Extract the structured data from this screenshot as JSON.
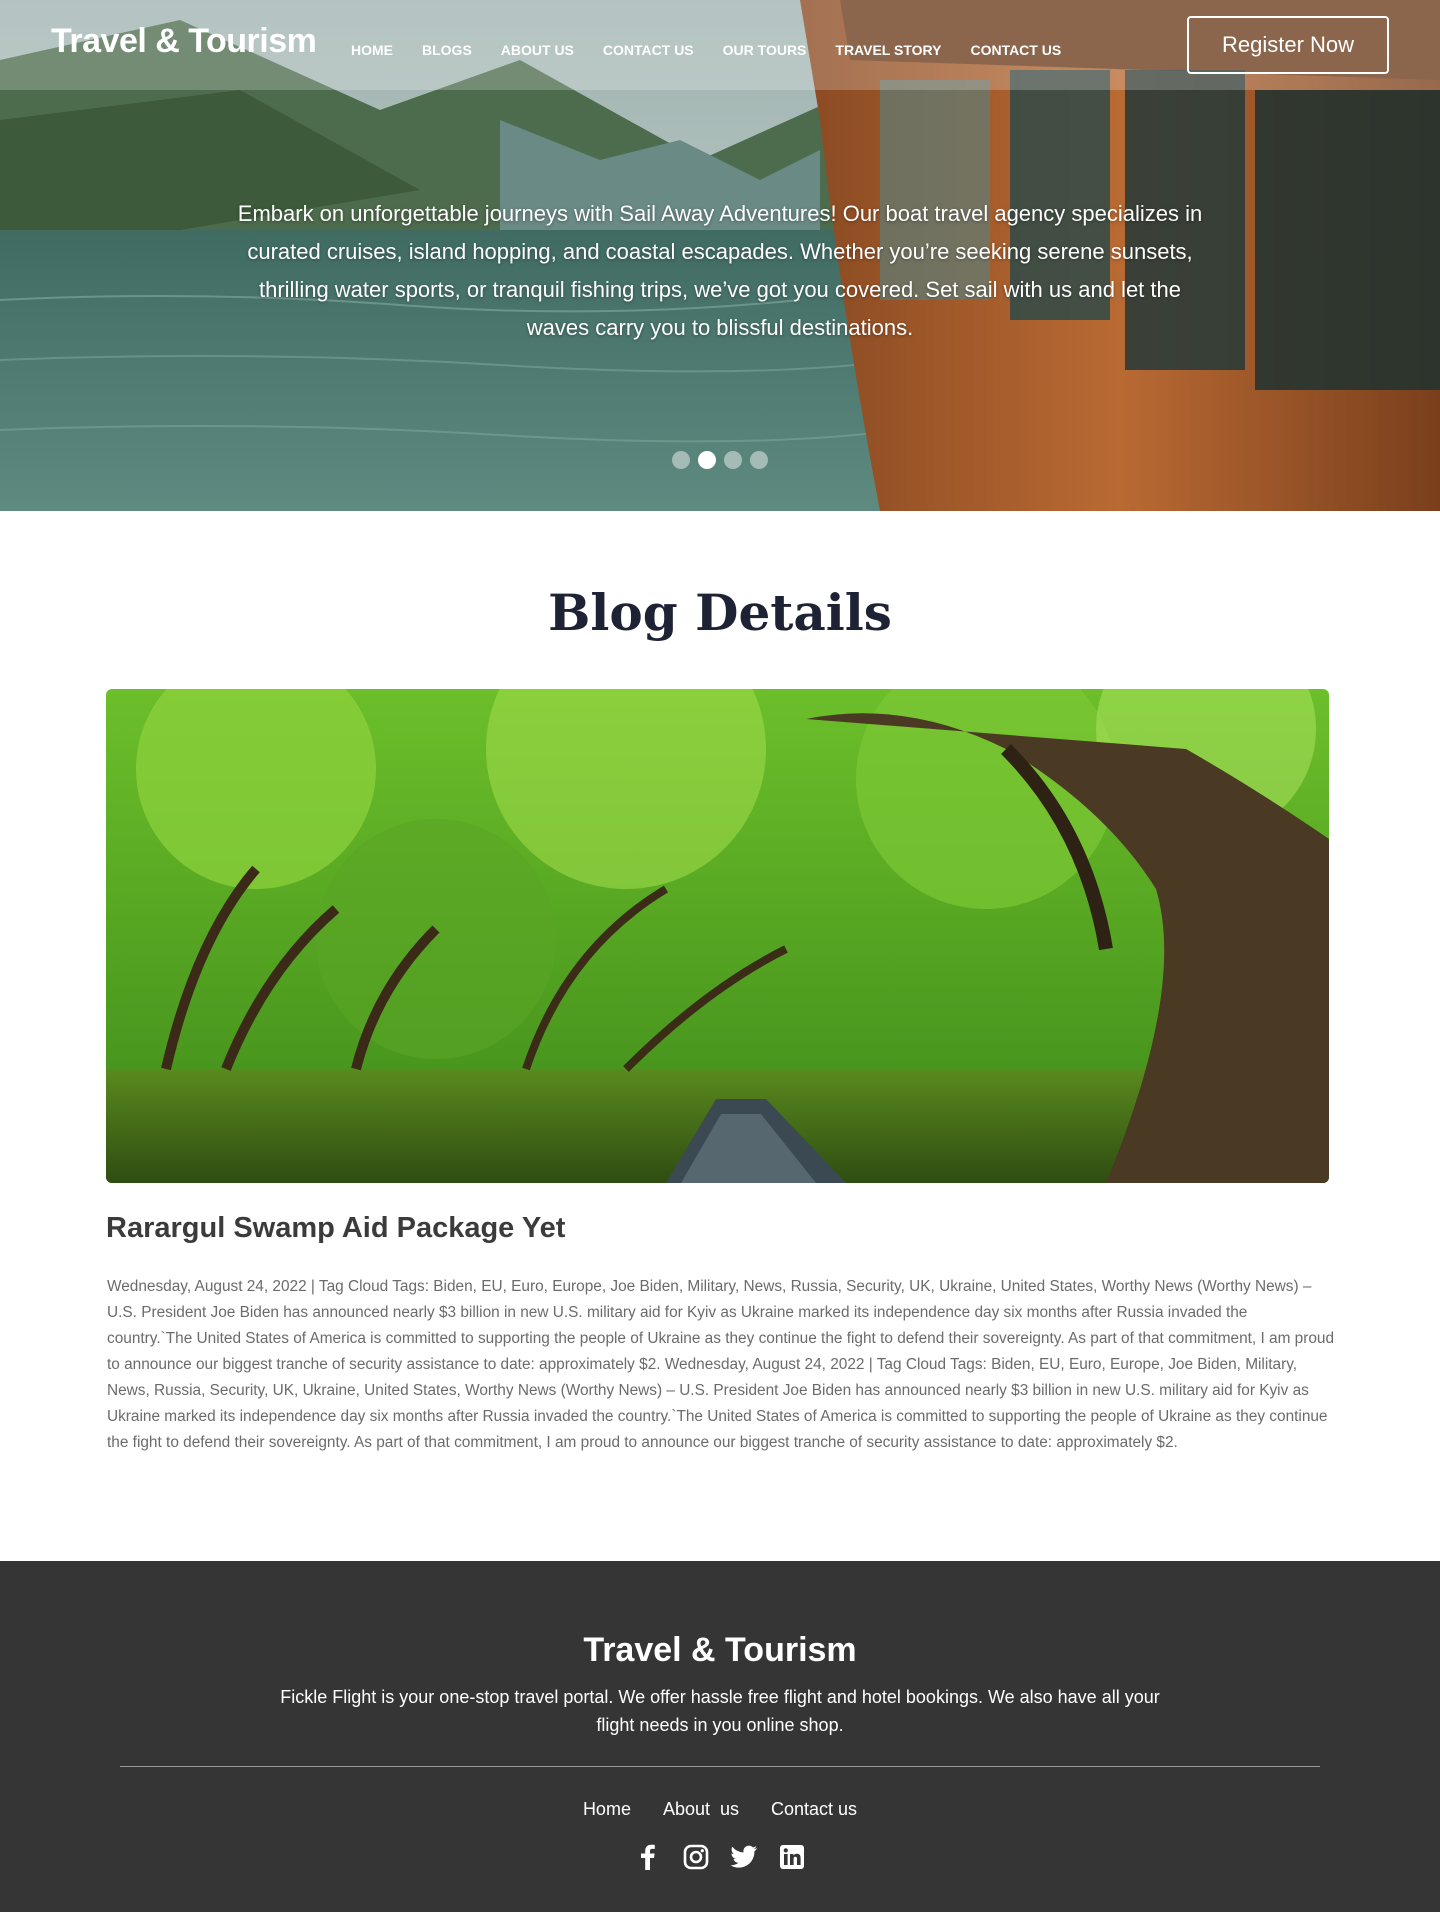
{
  "header": {
    "brand": "Travel & Tourism",
    "nav": [
      "HOME",
      "BLOGS",
      "ABOUT US",
      "CONTACT US",
      "OUR TOURS",
      "TRAVEL STORY",
      "CONTACT US"
    ],
    "register_label": "Register Now"
  },
  "hero": {
    "text": "Embark on unforgettable journeys with Sail Away Adventures! Our boat travel agency specializes in curated cruises, island hopping, and coastal escapades. Whether you’re seeking serene sunsets, thrilling water sports, or tranquil fishing trips, we’ve got you covered. Set sail with us and let the waves carry you to blissful destinations.",
    "slides_total": 4,
    "active_slide": 2
  },
  "blog": {
    "section_title": "Blog Details",
    "post_title": "Rarargul Swamp Aid Package Yet",
    "post_body": "Wednesday, August 24, 2022 | Tag Cloud Tags: Biden, EU, Euro, Europe, Joe Biden, Military, News, Russia, Security, UK, Ukraine, United States, Worthy News (Worthy News) – U.S. President Joe Biden has announced nearly $3 billion in new U.S. military aid for Kyiv as Ukraine marked its independence day six months after Russia invaded the country.`The United States of America is committed to supporting the people of Ukraine as they continue the fight to defend their sovereignty. As part of that commitment, I am proud to announce our biggest tranche of security assistance to date: approximately $2. Wednesday, August 24, 2022 | Tag Cloud Tags: Biden, EU, Euro, Europe, Joe Biden, Military, News, Russia, Security, UK, Ukraine, United States, Worthy News (Worthy News) – U.S. President Joe Biden has announced nearly $3 billion in new U.S. military aid for Kyiv as Ukraine marked its independence day six months after Russia invaded the country.`The United States of America is committed to supporting the people of Ukraine as they continue the fight to defend their sovereignty. As part of that commitment, I am proud to announce our biggest tranche of security assistance to date: approximately $2."
  },
  "footer": {
    "brand": "Travel & Tourism",
    "description": "Fickle Flight is your one-stop travel portal. We offer hassle free flight and hotel bookings. We also have all your flight needs in you online shop.",
    "links": [
      "Home",
      "About  us",
      "Contact us"
    ],
    "socials": [
      "facebook-icon",
      "instagram-icon",
      "twitter-icon",
      "linkedin-icon"
    ]
  },
  "colors": {
    "heading": "#1e2235",
    "footer_bg": "#353535",
    "body_text": "#6b6b6b"
  }
}
